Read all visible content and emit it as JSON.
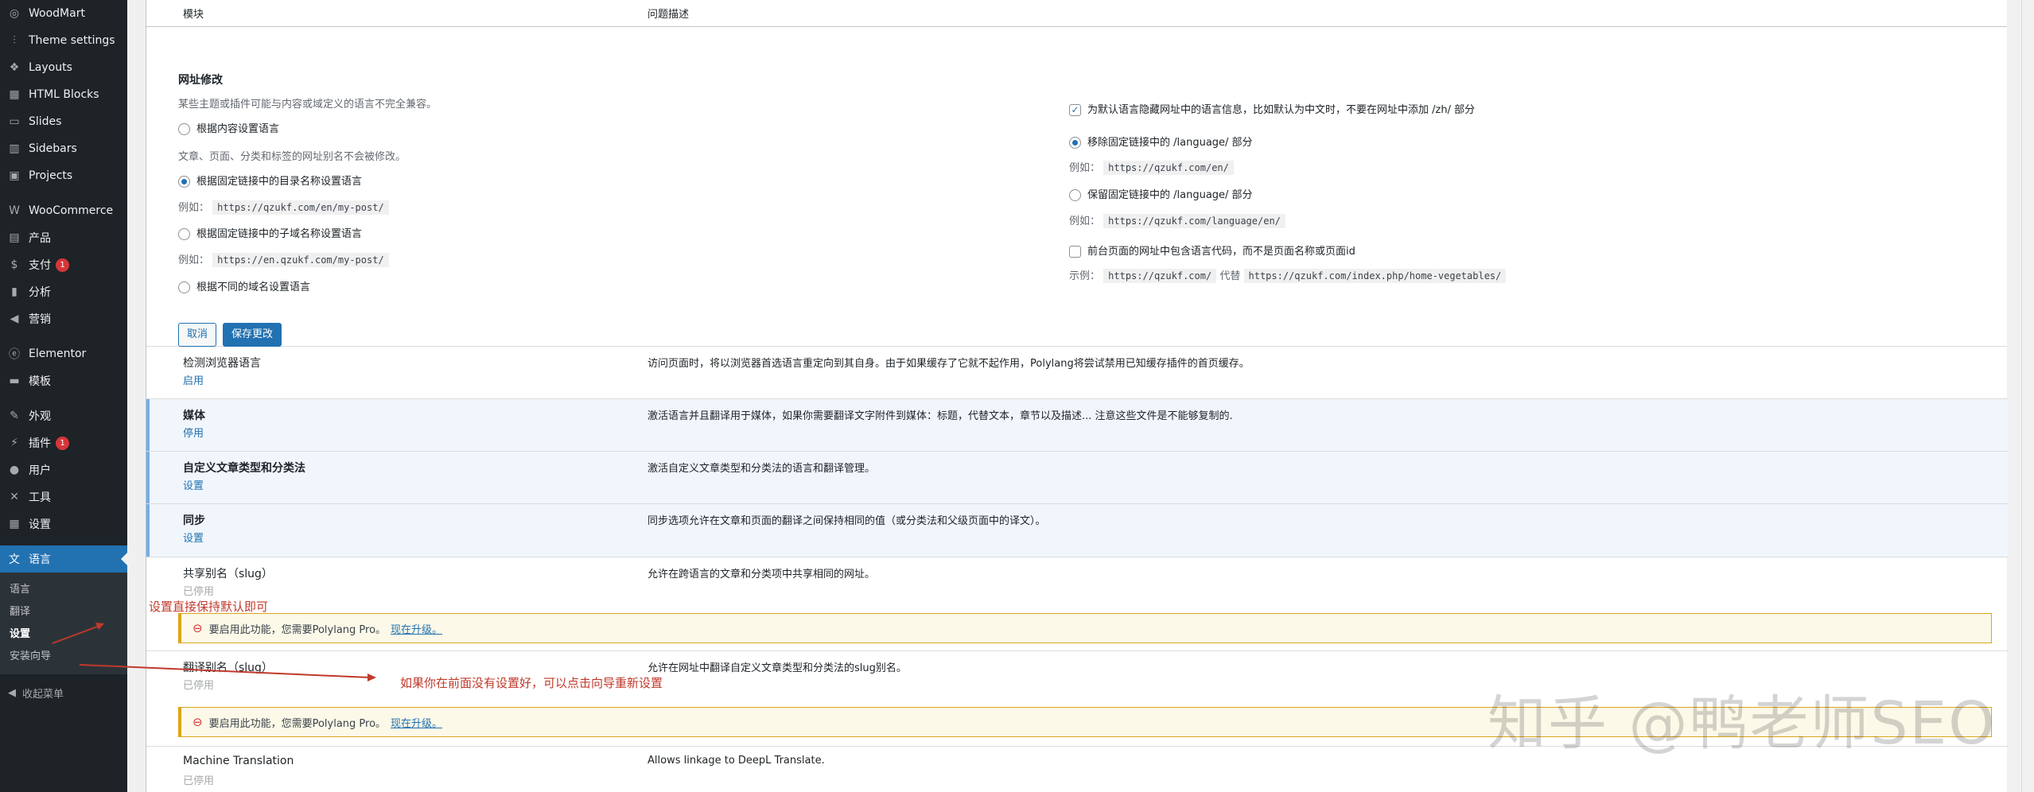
{
  "sidebar": {
    "items": [
      {
        "label": "WoodMart",
        "icon": "woodmart-icon",
        "glyph": "◎"
      },
      {
        "label": "Theme settings",
        "icon": "sliders-icon",
        "glyph": "⫶"
      },
      {
        "label": "Layouts",
        "icon": "layers-icon",
        "glyph": "❖"
      },
      {
        "label": "HTML Blocks",
        "icon": "html-block-icon",
        "glyph": "▦"
      },
      {
        "label": "Slides",
        "icon": "slides-icon",
        "glyph": "▭"
      },
      {
        "label": "Sidebars",
        "icon": "sidebar-icon",
        "glyph": "▥"
      },
      {
        "label": "Projects",
        "icon": "briefcase-icon",
        "glyph": "▣"
      }
    ],
    "items2": [
      {
        "label": "WooCommerce",
        "icon": "woocommerce-icon",
        "glyph": "W"
      },
      {
        "label": "产品",
        "icon": "product-icon",
        "glyph": "▤"
      },
      {
        "label": "支付",
        "icon": "payment-icon",
        "glyph": "$",
        "badge": "1"
      },
      {
        "label": "分析",
        "icon": "analytics-icon",
        "glyph": "▮"
      },
      {
        "label": "营销",
        "icon": "megaphone-icon",
        "glyph": "◀"
      }
    ],
    "items3": [
      {
        "label": "Elementor",
        "icon": "elementor-icon",
        "glyph": "ⓔ"
      },
      {
        "label": "模板",
        "icon": "folder-icon",
        "glyph": "▬"
      }
    ],
    "items4": [
      {
        "label": "外观",
        "icon": "brush-icon",
        "glyph": "✎"
      },
      {
        "label": "插件",
        "icon": "plugin-icon",
        "glyph": "⚡",
        "badge": "1"
      },
      {
        "label": "用户",
        "icon": "user-icon",
        "glyph": "●"
      },
      {
        "label": "工具",
        "icon": "wrench-icon",
        "glyph": "✕"
      },
      {
        "label": "设置",
        "icon": "settings-icon",
        "glyph": "▦"
      }
    ],
    "active": {
      "label": "语言",
      "icon": "language-icon",
      "glyph": "文"
    },
    "submenu": [
      "语言",
      "翻译",
      "设置",
      "安装向导"
    ],
    "collapse": "收起菜单"
  },
  "table_header": {
    "col1": "模块",
    "col2": "问题描述"
  },
  "url_section": {
    "title": "网址修改",
    "note": "某些主题或插件可能与内容或域定义的语言不完全兼容。",
    "opt1": "根据内容设置语言",
    "opt1_note": "文章、页面、分类和标签的网址别名不会被修改。",
    "opt2": "根据固定链接中的目录名称设置语言",
    "opt2_example_label": "例如：",
    "opt2_example": "https://qzukf.com/en/my-post/",
    "opt3": "根据固定链接中的子域名称设置语言",
    "opt3_example_label": "例如：",
    "opt3_example": "https://en.qzukf.com/my-post/",
    "opt4": "根据不同的域名设置语言",
    "right_check1": "为默认语言隐藏网址中的语言信息，比如默认为中文时，不要在网址中添加 /zh/ 部分",
    "right_opt1": "移除固定链接中的 /language/ 部分",
    "right_opt1_example_label": "例如：",
    "right_opt1_example": "https://qzukf.com/en/",
    "right_opt2": "保留固定链接中的 /language/ 部分",
    "right_opt2_example_label": "例如：",
    "right_opt2_example": "https://qzukf.com/language/en/",
    "right_check2": "前台页面的网址中包含语言代码，而不是页面名称或页面id",
    "right_check2_example_label": "示例：",
    "right_check2_example_a": "https://qzukf.com/",
    "right_check2_example_mid": "代替",
    "right_check2_example_b": "https://qzukf.com/index.php/home-vegetables/",
    "cancel": "取消",
    "save": "保存更改"
  },
  "modules": [
    {
      "name": "检测浏览器语言",
      "action": "启用",
      "desc": "访问页面时，将以浏览器首选语言重定向到其自身。由于如果缓存了它就不起作用，Polylang将尝试禁用已知缓存插件的首页缓存。"
    },
    {
      "name": "媒体",
      "action": "停用",
      "desc": "激活语言并且翻译用于媒体，如果你需要翻译文字附件到媒体：标题，代替文本，章节以及描述... 注意这些文件是不能够复制的."
    },
    {
      "name": "自定义文章类型和分类法",
      "action": "设置",
      "desc": "激活自定义文章类型和分类法的语言和翻译管理。"
    },
    {
      "name": "同步",
      "action": "设置",
      "desc": "同步选项允许在文章和页面的翻译之间保持相同的值（或分类法和父级页面中的译文）。"
    },
    {
      "name": "共享别名（slug）",
      "action": "已停用",
      "desc": "允许在跨语言的文章和分类项中共享相同的网址。"
    },
    {
      "name": "翻译别名（slug）",
      "action": "已停用",
      "desc": "允许在网址中翻译自定义文章类型和分类法的slug别名。"
    },
    {
      "name": "Machine Translation",
      "action": "已停用",
      "desc": "Allows linkage to DeepL Translate."
    }
  ],
  "notice": {
    "text": "要启用此功能，您需要Polylang Pro。",
    "link": "现在升级。"
  },
  "annotations": {
    "a1": "设置直接保持默认即可",
    "a2": "如果你在前面没有设置好，可以点击向导重新设置",
    "color": "#c0392b"
  },
  "watermark": "知乎 @鸭老师SEO",
  "colors": {
    "accent": "#2271b1",
    "sidebar": "#1d2327",
    "notice_border": "#dba617"
  }
}
